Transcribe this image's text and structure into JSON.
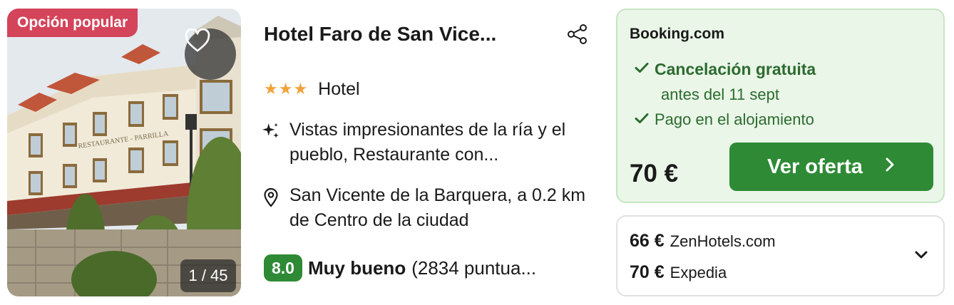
{
  "listing": {
    "badge": "Opción popular",
    "photo_counter": "1 / 45",
    "title": "Hotel Faro de San Vice...",
    "stars_display": "★★★",
    "type": "Hotel",
    "highlight": "Vistas impresionantes de la ría y el pueblo, Restaurante con...",
    "location": "San Vicente de la Barquera, a 0.2 km de Centro de la ciudad",
    "rating": {
      "score": "8.0",
      "word": "Muy bueno",
      "count": "(2834 puntua..."
    },
    "photo_sign": "RESTAURANTE - PARRILLA"
  },
  "offer": {
    "provider": "Booking.com",
    "cancellation": "Cancelación gratuita",
    "cancellation_until": "antes del 11 sept",
    "payment": "Pago en el alojamiento",
    "price": "70 €",
    "cta_label": "Ver oferta"
  },
  "other_offers": [
    {
      "price": "66 €",
      "provider": "ZenHotels.com"
    },
    {
      "price": "70 €",
      "provider": "Expedia"
    }
  ],
  "colors": {
    "badge": "#d4445a",
    "accent_green": "#2e8a35",
    "offer_bg": "#eaf6e8",
    "star": "#f0a23a"
  },
  "icons": [
    "heart-icon",
    "share-icon",
    "sparkle-icon",
    "location-pin-icon",
    "checkmark-icon",
    "chevron-right-icon",
    "chevron-down-icon"
  ]
}
